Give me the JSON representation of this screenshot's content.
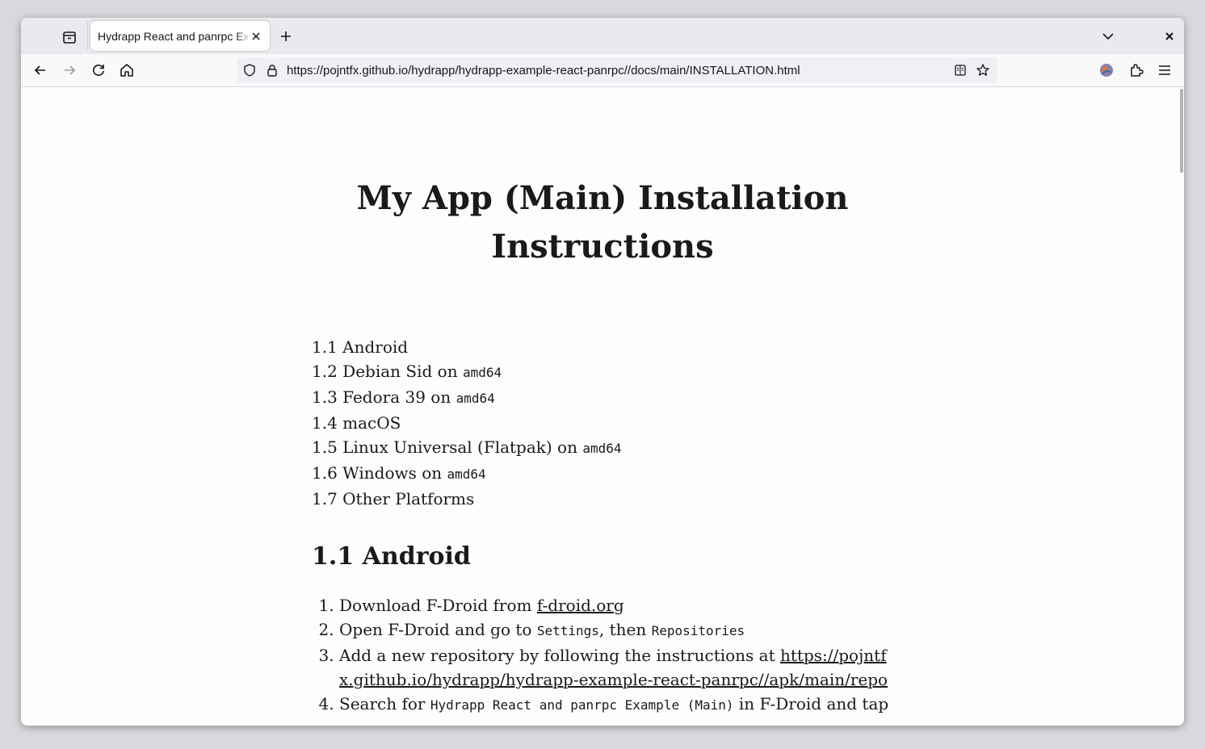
{
  "browser": {
    "tab": {
      "title": "Hydrapp React and panrpc Example"
    },
    "address_bar": {
      "url": "https://pojntfx.github.io/hydrapp/hydrapp-example-react-panrpc//docs/main/INSTALLATION.html"
    }
  },
  "doc": {
    "title": "My App (Main) Installation Instructions",
    "toc": [
      {
        "text": "1.1 Android"
      },
      {
        "text": "1.2 Debian Sid on ",
        "code": "amd64"
      },
      {
        "text": "1.3 Fedora 39 on ",
        "code": "amd64"
      },
      {
        "text": "1.4 macOS"
      },
      {
        "text": "1.5 Linux Universal (Flatpak) on ",
        "code": "amd64"
      },
      {
        "text": "1.6 Windows on ",
        "code": "amd64"
      },
      {
        "text": "1.7 Other Platforms"
      }
    ],
    "android": {
      "heading": "1.1 Android",
      "step1_text": "Download F-Droid from ",
      "step1_link": "f-droid.org",
      "step2_text": "Open F-Droid and go to ",
      "step2_code1": "Settings",
      "step2_mid": ", then ",
      "step2_code2": "Repositories",
      "step3_text": "Add a new repository by following the instructions at ",
      "step3_link": "https://pojntfx.github.io/hydrapp/hydrapp-example-react-panrpc//apk/main/repo",
      "step4_text": "Search for ",
      "step4_code": "Hydrapp React and panrpc Example (Main)",
      "step4_tail": " in F-Droid and tap"
    }
  }
}
